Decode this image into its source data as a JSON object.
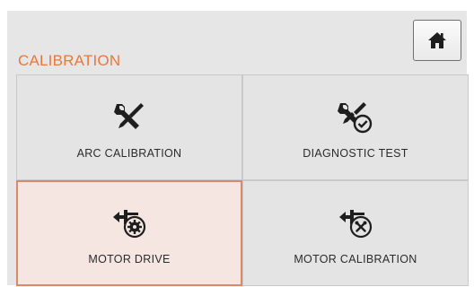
{
  "header": {
    "section_title": "CALIBRATION",
    "home_icon": "home-icon"
  },
  "tiles": [
    {
      "label": "ARC CALIBRATION",
      "icon": "wrench-screwdriver-icon",
      "active": false
    },
    {
      "label": "DIAGNOSTIC TEST",
      "icon": "tools-check-icon",
      "active": false
    },
    {
      "label": "MOTOR DRIVE",
      "icon": "motor-gear-icon",
      "active": true
    },
    {
      "label": "MOTOR CALIBRATION",
      "icon": "motor-wrench-icon",
      "active": false
    }
  ],
  "colors": {
    "accent": "#e8783c",
    "active_fill": "#f6e6e2",
    "active_border": "#d9876f",
    "icon": "#1e1e1e"
  }
}
